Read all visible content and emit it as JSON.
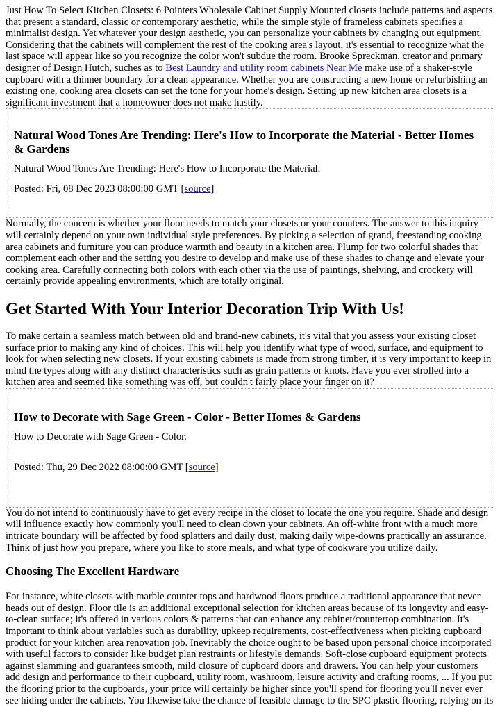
{
  "article": {
    "intro": {
      "before_link": "Just How To Select Kitchen Closets: 6 Pointers Wholesale Cabinet Supply Mounted closets include patterns and aspects that present a standard, classic or contemporary aesthetic, while the simple style of frameless cabinets specifies a minimalist design. Yet whatever your design aesthetic, you can personalize your cabinets by changing out equipment. Considering that the cabinets will complement the rest of the cooking area's layout, it's essential to recognize what the last space will appear like so you recognize the color won't subdue the room. Brooke Spreckman, creator and primary designer of Design Hutch, suches as to ",
      "link_text": "Best Laundry and utility room cabinets Near Me",
      "after_link": " make use of a shaker-style cupboard with a thinner boundary for a clean appearance. Whether you are constructing a new home or refurbishing an existing one, cooking area closets can set the tone for your home's design. Setting up new kitchen area closets is a significant investment that a homeowner does not make hastily."
    },
    "news_cards": [
      {
        "title": "Natural Wood Tones Are Trending: Here's How to Incorporate the Material - Better Homes & Gardens",
        "summary": "Natural Wood Tones Are Trending: Here's How to Incorporate the Material.",
        "posted_prefix": "Posted: Fri, 08 Dec 2023 08:00:00 GMT [",
        "source_label": "source",
        "posted_suffix": "]"
      },
      {
        "title": "How to Decorate with Sage Green - Color - Better Homes & Gardens",
        "summary": "How to Decorate with Sage Green - Color.",
        "posted_prefix": "Posted: Thu, 29 Dec 2022 08:00:00 GMT [",
        "source_label": "source",
        "posted_suffix": "]"
      }
    ],
    "paragraph_floor": "Normally, the concern is whether your floor needs to match your closets or your counters. The answer to this inquiry will certainly depend on your own individual style preferences. By picking a selection of grand, freestanding cooking area cabinets and furniture you can produce warmth and beauty in a kitchen area. Plump for two colorful shades that complement each other and the setting you desire to develop and make use of these shades to change and elevate your cooking area. Carefully connecting both colors with each other via the use of paintings, shelving, and crockery will certainly provide appealing environments, which are totally original.",
    "heading_main": "Get Started With Your Interior Decoration Trip With Us!",
    "paragraph_match": "To make certain a seamless match between old and brand-new cabinets, it's vital that you assess your existing closet surface prior to making any kind of choices. This will help you identify what type of wood, surface, and equipment to look for when selecting new closets. If your existing cabinets is made from strong timber, it is very important to keep in mind the types along with any distinct characteristics such as grain patterns or knots. Have you ever strolled into a kitchen area and seemed like something was off, but couldn't fairly place your finger on it?",
    "paragraph_recipe": "You do not intend to continuously have to get every recipe in the closet to locate the one you require. Shade and design will influence exactly how commonly you'll need to clean down your cabinets. An off-white front with a much more intricate boundary will be affected by food splatters and daily dust, making daily wipe-downs practically an assurance. Think of just how you prepare, where you like to store meals, and what type of cookware you utilize daily.",
    "heading_hardware": "Choosing The Excellent Hardware",
    "paragraph_hardware": "For instance, white closets with marble counter tops and hardwood floors produce a traditional appearance that never heads out of design. Floor tile is an additional exceptional selection for kitchen areas because of its longevity and easy-to-clean surface; it's offered in various colors & patterns that can enhance any cabinet/countertop combination. It's important to think about variables such as durability, upkeep requirements, cost-effectiveness when picking cupboard product for your kitchen area renovation job. Inevitably the choice ought to be based upon personal choice incorporated with useful factors to consider like budget plan restraints or lifestyle demands. Soft-close cupboard equipment protects against slamming and guarantees smooth, mild closure of cupboard doors and drawers. You can help your customers add design and performance to their cupboard, utility room, washroom, leisure activity and crafting rooms, ... If you put the flooring prior to the cupboards, your price will certainly be higher since you'll spend for flooring you'll never ever see hiding under the cabinets. You likewise take the chance of feasible damage to the SPC plastic flooring, relying on its"
  },
  "colors": {
    "link": "#1a0dab",
    "text": "#000000",
    "card_border": "#9a9a9a"
  }
}
